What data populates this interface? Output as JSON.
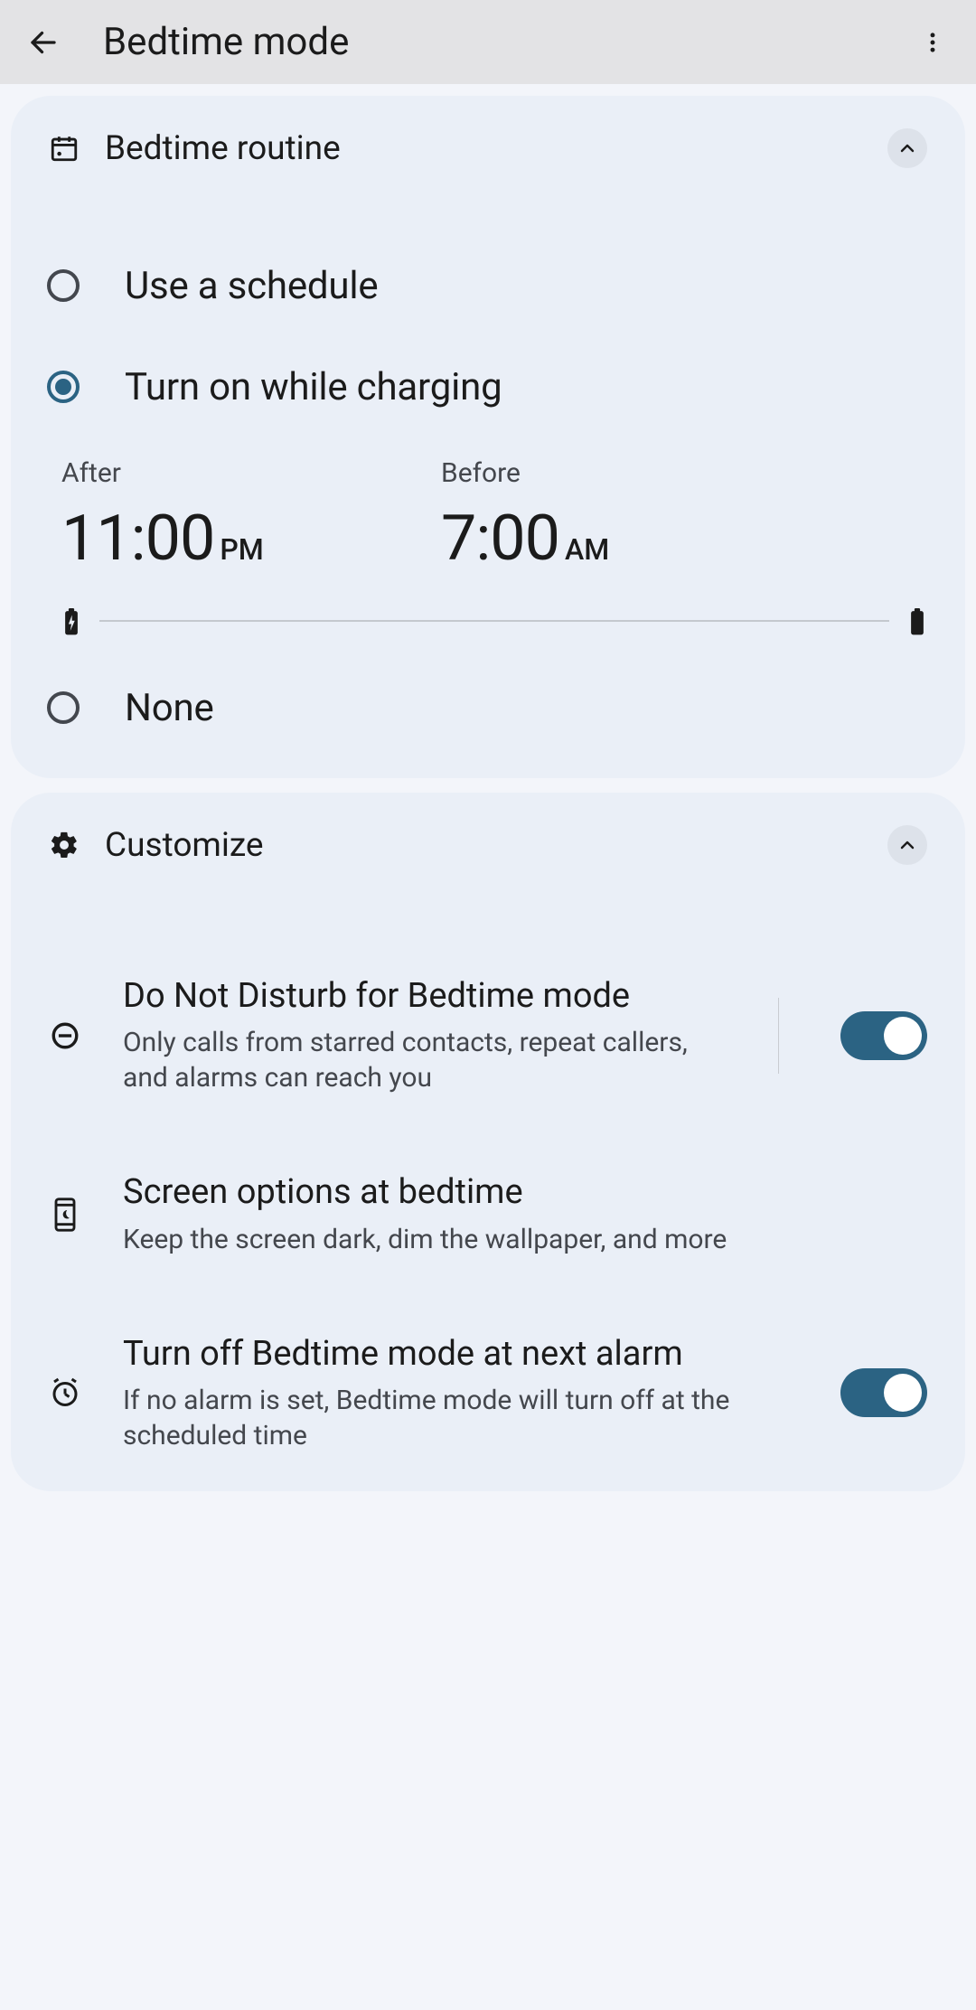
{
  "appbar": {
    "title": "Bedtime mode"
  },
  "routine": {
    "header": "Bedtime routine",
    "options": {
      "schedule": "Use a schedule",
      "charging": "Turn on while charging",
      "none": "None"
    },
    "selected": "charging",
    "after_label": "After",
    "after_time": "11:00",
    "after_ampm": "PM",
    "before_label": "Before",
    "before_time": "7:00",
    "before_ampm": "AM"
  },
  "customize": {
    "header": "Customize",
    "dnd": {
      "title": "Do Not Disturb for Bedtime mode",
      "sub": "Only calls from starred contacts, repeat callers, and alarms can reach you",
      "enabled": true
    },
    "screen": {
      "title": "Screen options at bedtime",
      "sub": "Keep the screen dark, dim the wallpaper, and more"
    },
    "alarm_off": {
      "title": "Turn off Bedtime mode at next alarm",
      "sub": "If no alarm is set, Bedtime mode will turn off at the scheduled time",
      "enabled": true
    }
  }
}
